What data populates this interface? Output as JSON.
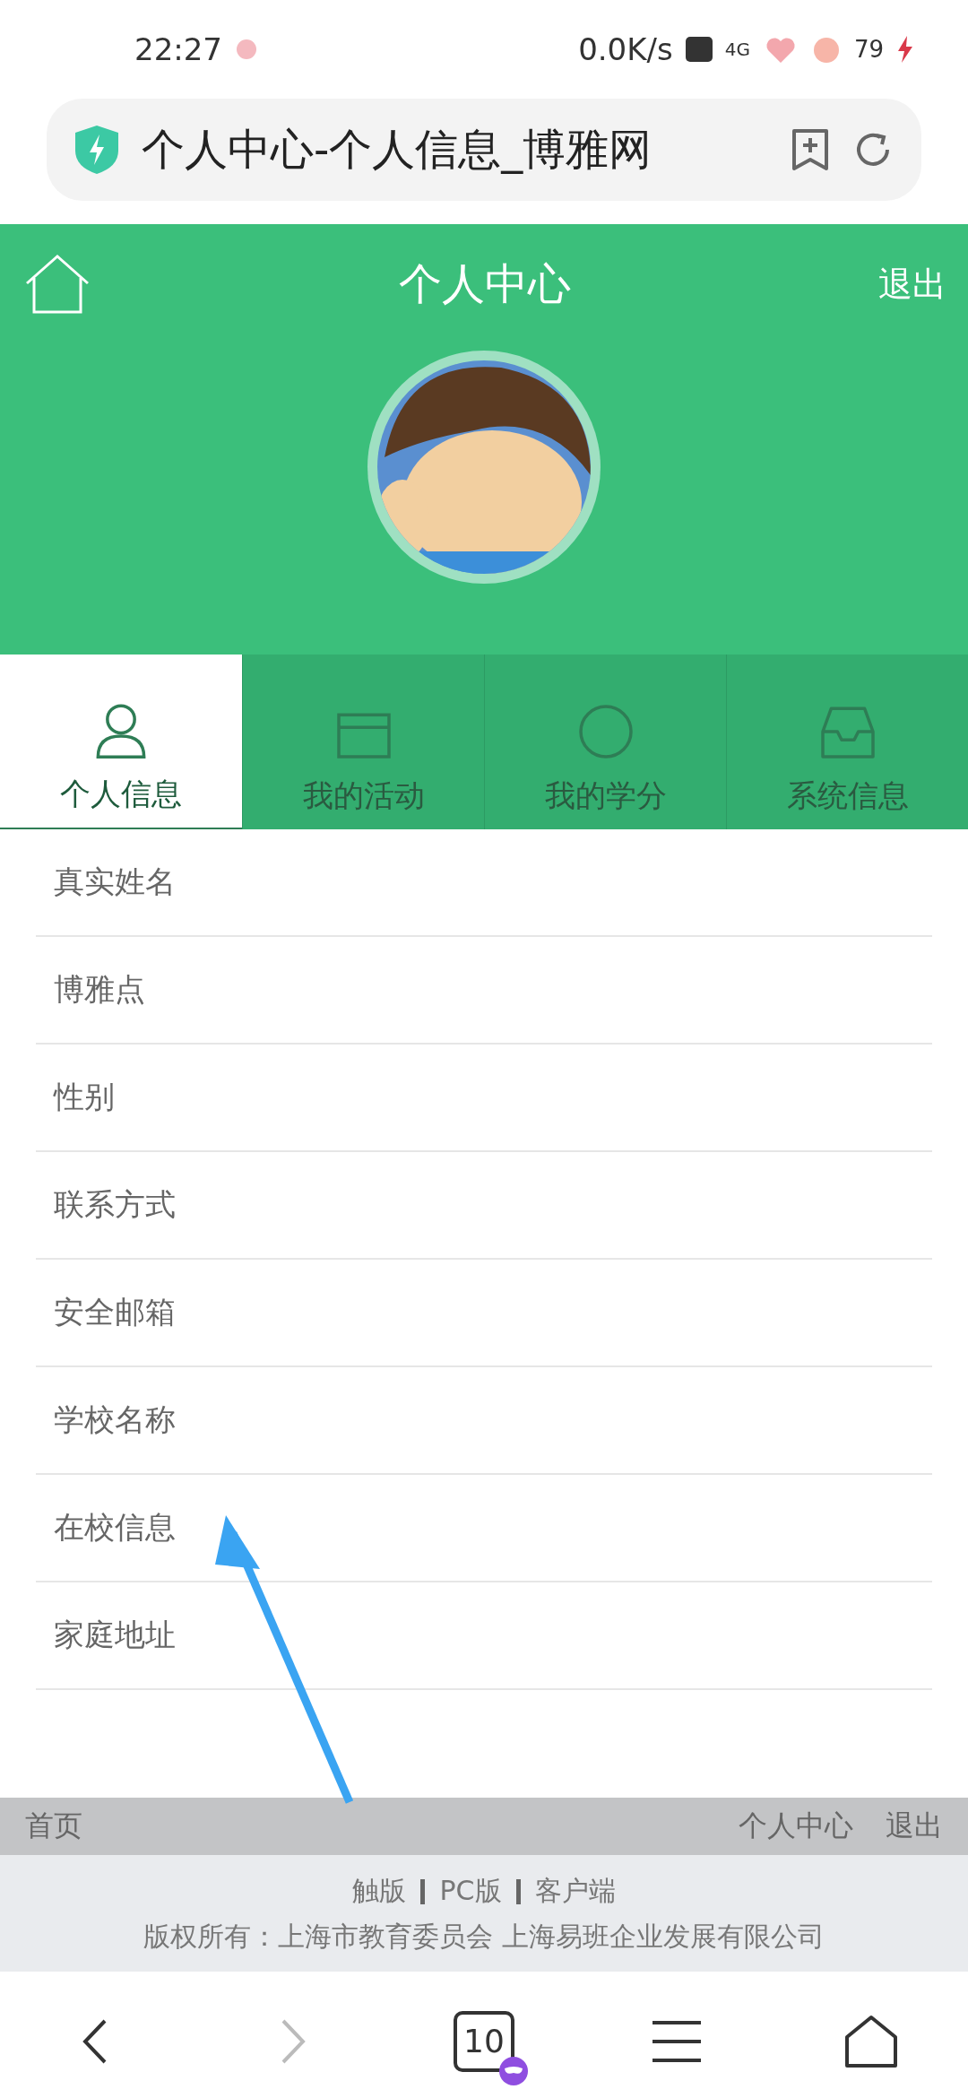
{
  "status_bar": {
    "time": "22:27",
    "speed": "0.0K/s",
    "network": "4G",
    "battery": "79"
  },
  "address_bar": {
    "title": "个人中心-个人信息_博雅网"
  },
  "header": {
    "title": "个人中心",
    "logout": "退出"
  },
  "tabs": [
    {
      "label": "个人信息",
      "kind": "person",
      "selected": true
    },
    {
      "label": "我的活动",
      "kind": "calendar",
      "selected": false
    },
    {
      "label": "我的学分",
      "kind": "coin",
      "selected": false
    },
    {
      "label": "系统信息",
      "kind": "inbox",
      "selected": false
    }
  ],
  "fields": [
    {
      "label": "真实姓名"
    },
    {
      "label": "博雅点"
    },
    {
      "label": "性别"
    },
    {
      "label": "联系方式"
    },
    {
      "label": "安全邮箱"
    },
    {
      "label": "学校名称"
    },
    {
      "label": "在校信息"
    },
    {
      "label": "家庭地址"
    }
  ],
  "footer_nav": {
    "left": "首页",
    "links": [
      "个人中心",
      "退出"
    ]
  },
  "footer": {
    "versions": [
      "触版",
      "PC版",
      "客户端"
    ],
    "copyright": "版权所有：上海市教育委员会 上海易班企业发展有限公司"
  },
  "browser_nav": {
    "tabs_count": "10"
  }
}
